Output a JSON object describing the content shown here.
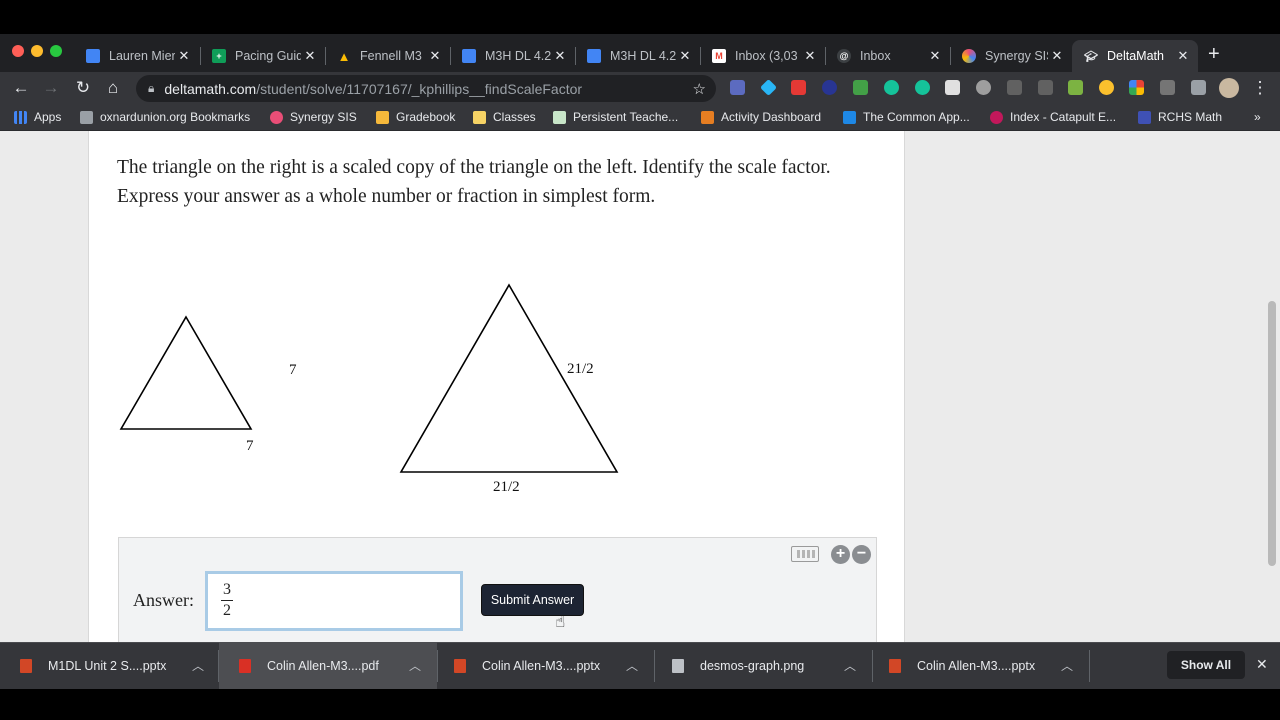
{
  "browser": {
    "tabs": [
      {
        "title": "Lauren Mier",
        "icon": "docs-icon",
        "color": "#4285f4"
      },
      {
        "title": "Pacing Guid",
        "icon": "sheets-icon",
        "color": "#0f9d58"
      },
      {
        "title": "Fennell M3",
        "icon": "drive-icon",
        "color": "#fbbc04"
      },
      {
        "title": "M3H DL 4.2",
        "icon": "docs-icon",
        "color": "#4285f4"
      },
      {
        "title": "M3H DL 4.2",
        "icon": "docs-icon",
        "color": "#4285f4"
      },
      {
        "title": "Inbox (3,03",
        "icon": "gmail-icon",
        "color": "#ea4335"
      },
      {
        "title": "Inbox",
        "icon": "mail-icon",
        "color": "#5f6368"
      },
      {
        "title": "Synergy SIS",
        "icon": "synergy-icon",
        "color": "#e94e77"
      },
      {
        "title": "DeltaMath",
        "icon": "graduation-cap-icon",
        "color": "#ffffff",
        "active": true
      }
    ],
    "url_host": "deltamath.com",
    "url_path": "/student/solve/11707167/_kphillips__findScaleFactor",
    "bookmarks": [
      {
        "label": "Apps",
        "color": "#4285f4"
      },
      {
        "label": "oxnardunion.org Bookmarks",
        "color": "#9aa0a6"
      },
      {
        "label": "Synergy SIS",
        "color": "#e94e77"
      },
      {
        "label": "Gradebook",
        "color": "#f6b93b"
      },
      {
        "label": "Classes",
        "color": "#f6d365"
      },
      {
        "label": "Persistent Teache...",
        "color": "#c8e6c9"
      },
      {
        "label": "Activity Dashboard",
        "color": "#e67e22"
      },
      {
        "label": "The Common App...",
        "color": "#1e88e5"
      },
      {
        "label": "Index - Catapult E...",
        "color": "#c2185b"
      },
      {
        "label": "RCHS Math",
        "color": "#3f51b5"
      }
    ],
    "more_bookmarks": "»"
  },
  "problem": {
    "text": "The triangle on the right is a scaled copy of the triangle on the left. Identify the scale factor. Express your answer as a whole number or fraction in simplest form.",
    "small_triangle": {
      "side_label": "7",
      "base_label": "7"
    },
    "large_triangle": {
      "side_label": "21/2",
      "base_label": "21/2"
    }
  },
  "answer": {
    "label": "Answer:",
    "numerator": "3",
    "denominator": "2",
    "submit_label": "Submit Answer"
  },
  "downloads": {
    "items": [
      {
        "name": "M1DL Unit 2 S....pptx",
        "color": "#d24726"
      },
      {
        "name": "Colin Allen-M3....pdf",
        "color": "#d93025",
        "highlighted": true
      },
      {
        "name": "Colin Allen-M3....pptx",
        "color": "#d24726"
      },
      {
        "name": "desmos-graph.png",
        "color": "#bdc1c6"
      },
      {
        "name": "Colin Allen-M3....pptx",
        "color": "#d24726"
      }
    ],
    "show_all": "Show All"
  }
}
